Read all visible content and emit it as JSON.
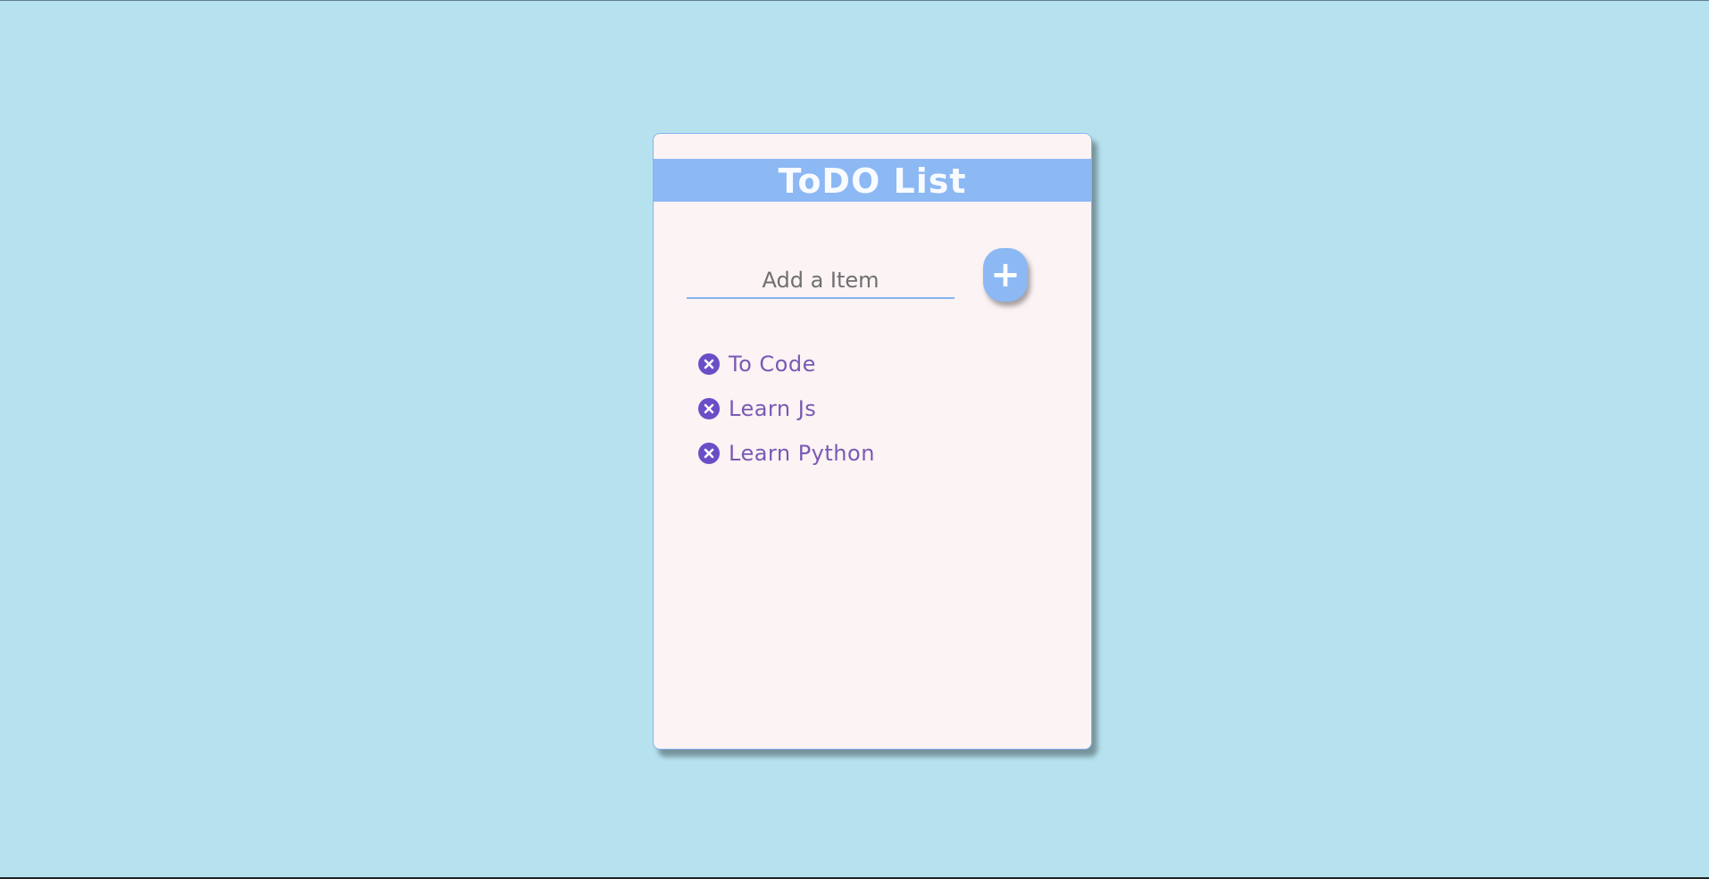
{
  "app": {
    "title": "ToDO List"
  },
  "input": {
    "placeholder": "Add a Item",
    "value": ""
  },
  "add_button": {
    "label": "+"
  },
  "items": [
    {
      "label": "To Code",
      "icon": "remove-circle-icon"
    },
    {
      "label": "Learn Js",
      "icon": "remove-circle-icon"
    },
    {
      "label": "Learn Python",
      "icon": "remove-circle-icon"
    }
  ],
  "colors": {
    "background": "#b6e2ef",
    "card": "#fbf3f4",
    "accent": "#8cb8f4",
    "item_text": "#7a59b4",
    "remove_icon": "#6a4ec7"
  }
}
